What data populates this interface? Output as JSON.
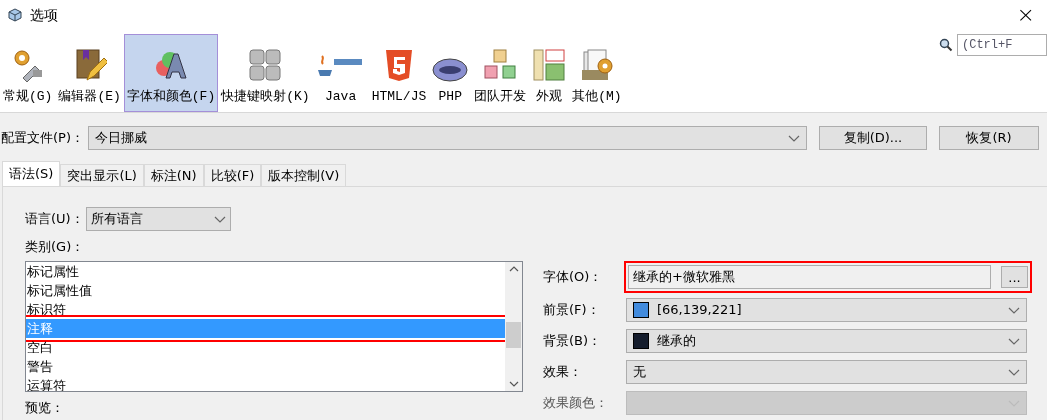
{
  "window": {
    "title": "选项",
    "close": "×"
  },
  "search": {
    "placeholder": "(Ctrl+F"
  },
  "toolbar": [
    {
      "label": "常规(G)",
      "selected": false
    },
    {
      "label": "编辑器(E)",
      "selected": false
    },
    {
      "label": "字体和颜色(F)",
      "selected": true
    },
    {
      "label": "快捷键映射(K)",
      "selected": false
    },
    {
      "label": "Java",
      "selected": false
    },
    {
      "label": "HTML/JS",
      "selected": false
    },
    {
      "label": "PHP",
      "selected": false
    },
    {
      "label": "团队开发",
      "selected": false
    },
    {
      "label": "外观",
      "selected": false
    },
    {
      "label": "其他(M)",
      "selected": false
    }
  ],
  "profile": {
    "label": "配置文件(P)：",
    "value": "今日挪威",
    "buttons": [
      "复制(D)...",
      "恢复(R)"
    ]
  },
  "tabs": [
    {
      "label": "语法(S)",
      "selected": true
    },
    {
      "label": "突出显示(L)",
      "selected": false
    },
    {
      "label": "标注(N)",
      "selected": false
    },
    {
      "label": "比较(F)",
      "selected": false
    },
    {
      "label": "版本控制(V)",
      "selected": false
    }
  ],
  "language": {
    "label": "语言(U)：",
    "value": "所有语言"
  },
  "category": {
    "label": "类别(G)：",
    "items": [
      {
        "label": "标记属性",
        "selected": false,
        "highlighted": false
      },
      {
        "label": "标记属性值",
        "selected": false,
        "highlighted": false
      },
      {
        "label": "标识符",
        "selected": false,
        "highlighted": false
      },
      {
        "label": "注释",
        "selected": true,
        "highlighted": true
      },
      {
        "label": "空白",
        "selected": false,
        "highlighted": false
      },
      {
        "label": "警告",
        "selected": false,
        "highlighted": false
      },
      {
        "label": "运算符",
        "selected": false,
        "highlighted": false
      }
    ]
  },
  "preview": {
    "label": "预览："
  },
  "properties": [
    {
      "kind": "font",
      "label": "字体(O)：",
      "value": "继承的+微软雅黑",
      "button": "...",
      "highlighted": true
    },
    {
      "kind": "color",
      "label": "前景(F)：",
      "value": "[66,139,221]",
      "color": "#428bdd"
    },
    {
      "kind": "color",
      "label": "背景(B)：",
      "value": "继承的",
      "color": "#141c2c"
    },
    {
      "kind": "select",
      "label": "效果：",
      "value": "无",
      "disabled": false
    },
    {
      "kind": "select",
      "label": "效果颜色：",
      "disabled": true
    }
  ]
}
